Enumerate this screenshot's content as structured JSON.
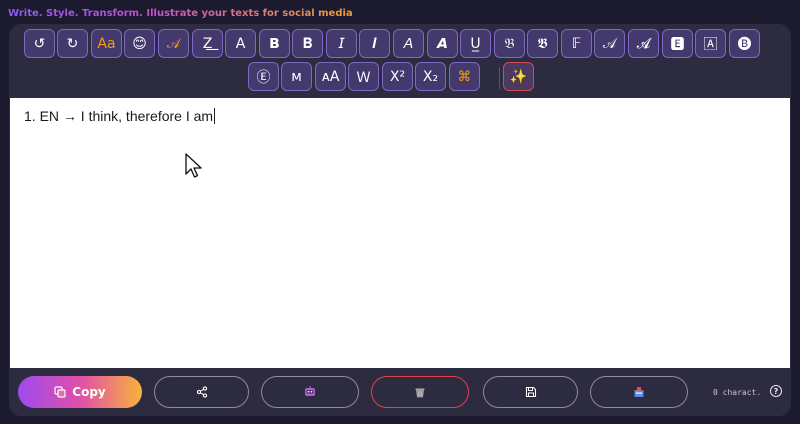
{
  "header": {
    "tagline": "Write. Style. Transform. Illustrate your texts for social media"
  },
  "toolbar": {
    "row1": [
      {
        "label": "↺",
        "name": "undo-button"
      },
      {
        "label": "↻",
        "name": "redo-button"
      },
      {
        "label": "Aa",
        "name": "case-button",
        "accent": true
      },
      {
        "label": "😊",
        "name": "emoji-button"
      },
      {
        "label": "𝒜",
        "name": "script-style-button",
        "accent": true
      },
      {
        "label": "Z͟",
        "name": "strike-style-button"
      },
      {
        "label": "A",
        "name": "plain-style-button"
      },
      {
        "label": "𝗕",
        "name": "bold-sans-button"
      },
      {
        "label": "𝐁",
        "name": "bold-serif-button"
      },
      {
        "label": "𝘐",
        "name": "italic-sans-button"
      },
      {
        "label": "𝑰",
        "name": "bold-italic-serif-button"
      },
      {
        "label": "𝘈",
        "name": "italic-button"
      },
      {
        "label": "𝘼",
        "name": "bold-italic-button"
      },
      {
        "label": "U̲",
        "name": "underline-button"
      },
      {
        "label": "𝔅",
        "name": "fraktur-button"
      },
      {
        "label": "𝕭",
        "name": "bold-fraktur-button"
      },
      {
        "label": "𝔽",
        "name": "double-struck-button"
      },
      {
        "label": "𝒜",
        "name": "script-button"
      },
      {
        "label": "𝓐",
        "name": "bold-script-button"
      },
      {
        "label": "🅴",
        "name": "negative-square-button"
      },
      {
        "label": "🄰",
        "name": "squared-button"
      },
      {
        "label": "🅑",
        "name": "negative-circle-button"
      }
    ],
    "row2": [
      {
        "label": "Ⓔ",
        "name": "circled-button"
      },
      {
        "label": "ᴍ",
        "name": "small-caps-button"
      },
      {
        "label": "ᴀA",
        "name": "mixed-caps-button"
      },
      {
        "label": "Ｗ",
        "name": "fullwidth-button"
      },
      {
        "label": "X²",
        "name": "superscript-button"
      },
      {
        "label": "X₂",
        "name": "subscript-button"
      },
      {
        "label": "⌘",
        "name": "symbols-button",
        "accent": true
      }
    ],
    "magic": {
      "label": "✨",
      "name": "magic-button"
    }
  },
  "editor": {
    "text": "1. EN → I think, therefore I am"
  },
  "bottom": {
    "copy_label": "Copy",
    "share_icon": "share-icon",
    "robot_icon": "robot-icon",
    "trash_icon": "trash-icon",
    "save_icon": "save-icon",
    "inbox_icon": "inbox-icon",
    "char_count": "0 charact.",
    "help_label": "?"
  }
}
